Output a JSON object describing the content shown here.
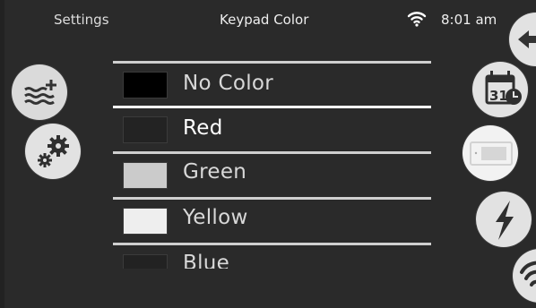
{
  "header": {
    "left_label": "Settings",
    "title": "Keypad Color",
    "time": "8:01 am",
    "wifi_icon": "wifi-icon"
  },
  "left_nav": [
    {
      "icon": "water-add-icon"
    },
    {
      "icon": "gears-icon"
    }
  ],
  "right_nav": [
    {
      "icon": "back-arrow-icon"
    },
    {
      "icon": "calendar-clock-icon",
      "calendar_day": "31"
    },
    {
      "icon": "keypad-device-icon"
    },
    {
      "icon": "lightning-icon"
    },
    {
      "icon": "wifi-icon"
    }
  ],
  "colors": {
    "background": "#2a2a2a",
    "button": "#e2e2e2",
    "separator": "#cfcfcf"
  },
  "color_list": [
    {
      "name": "No Color",
      "swatch": "#000000",
      "selected": false
    },
    {
      "name": "Red",
      "swatch": "#232323",
      "selected": true
    },
    {
      "name": "Green",
      "swatch": "#cbcbcb",
      "selected": false
    },
    {
      "name": "Yellow",
      "swatch": "#eeeeee",
      "selected": false
    },
    {
      "name": "Blue",
      "swatch": "#222222",
      "selected": false
    }
  ]
}
